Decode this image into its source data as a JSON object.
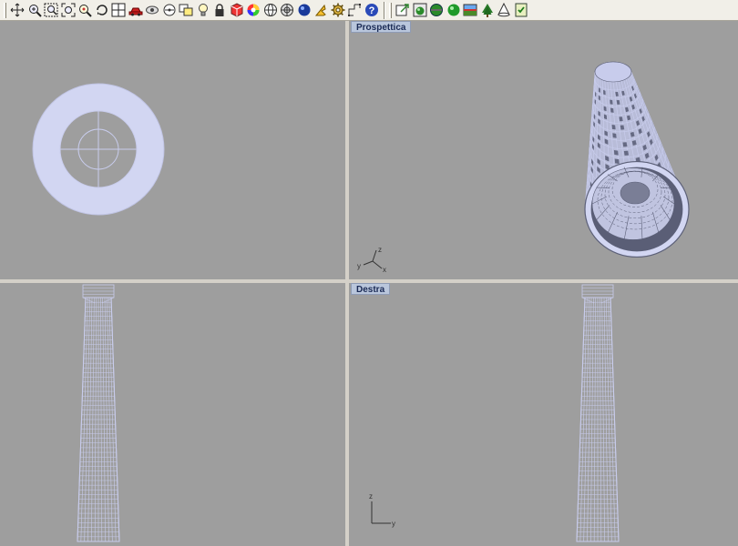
{
  "toolbar": {
    "main_icons": [
      "pan-icon",
      "zoom-in-icon",
      "zoom-window-icon",
      "zoom-extents-icon",
      "zoom-selected-icon",
      "rotate-view-icon",
      "four-viewports-icon",
      "car-icon",
      "hide-icon",
      "point-off-icon",
      "named-view-icon",
      "lightbulb-icon",
      "lock-icon",
      "properties-icon",
      "color-wheel-icon",
      "sphere-grid-icon",
      "snap-icon",
      "render-sphere-icon",
      "pick-icon",
      "gear-icon",
      "curve-tools-icon",
      "help-icon"
    ],
    "render_icons": [
      "export-icon",
      "render-icon",
      "render-preview-icon",
      "green-sphere-icon",
      "environment-icon",
      "tree-icon",
      "light-cone-icon",
      "script-icon"
    ]
  },
  "viewports": {
    "top": {
      "title": ""
    },
    "perspective": {
      "title": "Prospettica",
      "axis": {
        "z": "z",
        "y": "y",
        "x": "x"
      }
    },
    "front": {
      "title": ""
    },
    "right": {
      "title": "Destra",
      "axis": {
        "z": "z",
        "y": "y"
      }
    }
  },
  "colors": {
    "viewport_bg": "#9e9e9e",
    "wire": "#c8ccec",
    "wire_dark": "#5c6078",
    "ring_fill": "#d2d6f2",
    "title_bg": "#b9c6dc"
  }
}
